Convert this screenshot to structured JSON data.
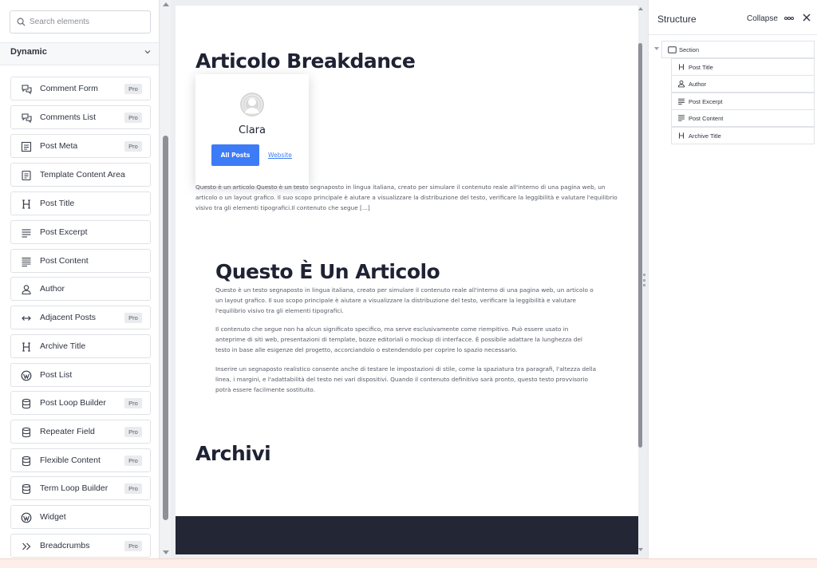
{
  "search": {
    "placeholder": "Search elements",
    "value": ""
  },
  "category": {
    "label": "Dynamic"
  },
  "elements": [
    {
      "label": "Comment Form",
      "icon": "comments-icon",
      "pro": "Pro"
    },
    {
      "label": "Comments List",
      "icon": "comments-icon",
      "pro": "Pro"
    },
    {
      "label": "Post Meta",
      "icon": "post-meta-icon",
      "pro": "Pro"
    },
    {
      "label": "Template Content Area",
      "icon": "template-icon",
      "pro": ""
    },
    {
      "label": "Post Title",
      "icon": "heading-icon",
      "pro": ""
    },
    {
      "label": "Post Excerpt",
      "icon": "text-lines-icon",
      "pro": ""
    },
    {
      "label": "Post Content",
      "icon": "text-block-icon",
      "pro": ""
    },
    {
      "label": "Author",
      "icon": "user-icon",
      "pro": ""
    },
    {
      "label": "Adjacent Posts",
      "icon": "arrows-horizontal-icon",
      "pro": "Pro"
    },
    {
      "label": "Archive Title",
      "icon": "heading-icon",
      "pro": ""
    },
    {
      "label": "Post List",
      "icon": "wordpress-icon",
      "pro": ""
    },
    {
      "label": "Post Loop Builder",
      "icon": "database-icon",
      "pro": "Pro"
    },
    {
      "label": "Repeater Field",
      "icon": "database-icon",
      "pro": "Pro"
    },
    {
      "label": "Flexible Content",
      "icon": "database-icon",
      "pro": "Pro"
    },
    {
      "label": "Term Loop Builder",
      "icon": "database-icon",
      "pro": "Pro"
    },
    {
      "label": "Widget",
      "icon": "wordpress-icon",
      "pro": ""
    },
    {
      "label": "Breadcrumbs",
      "icon": "chevrons-right-icon",
      "pro": "Pro"
    }
  ],
  "canvas": {
    "post_title": "Articolo Breakdance",
    "author": {
      "name": "Clara",
      "button": "All Posts",
      "link": "Website"
    },
    "excerpt": "Questo è un articolo Questo è un testo segnaposto in lingua italiana, creato per simulare il contenuto reale all'interno di una pagina web, un articolo o un layout grafico. Il suo scopo principale è aiutare a visualizzare la distribuzione del testo, verificare la leggibilità e valutare l'equilibrio visivo tra gli elementi tipografici.Il contenuto che segue [...]",
    "content_title": "Questo È Un Articolo",
    "content_paragraphs": [
      "Questo è un testo segnaposto in lingua italiana, creato per simulare il contenuto reale all'interno di una pagina web, un articolo o un layout grafico. Il suo scopo principale è aiutare a visualizzare la distribuzione del testo, verificare la leggibilità e valutare l'equilibrio visivo tra gli elementi tipografici.",
      "Il contenuto che segue non ha alcun significato specifico, ma serve esclusivamente come riempitivo. Può essere usato in anteprime di siti web, presentazioni di template, bozze editoriali o mockup di interfacce. È possibile adattare la lunghezza del testo in base alle esigenze del progetto, accorciandolo o estendendolo per coprire lo spazio necessario.",
      "Inserire un segnaposto realistico consente anche di testare le impostazioni di stile, come la spaziatura tra paragrafi, l'altezza della linea, i margini, e l'adattabilità del testo nei vari dispositivi. Quando il contenuto definitivo sarà pronto, questo testo provvisorio potrà essere facilmente sostituito."
    ],
    "archive_title": "Archivi"
  },
  "structure": {
    "title": "Structure",
    "collapse": "Collapse",
    "tree": [
      {
        "label": "Section",
        "icon": "section-icon"
      },
      {
        "label": "Post Title",
        "icon": "heading-icon"
      },
      {
        "label": "Author",
        "icon": "user-icon"
      },
      {
        "label": "Post Excerpt",
        "icon": "text-lines-icon"
      },
      {
        "label": "Post Content",
        "icon": "text-block-icon"
      },
      {
        "label": "Archive Title",
        "icon": "heading-icon"
      }
    ]
  },
  "colors": {
    "accent": "#3d7cf6",
    "footer": "#232634",
    "heading": "#1e2233"
  }
}
